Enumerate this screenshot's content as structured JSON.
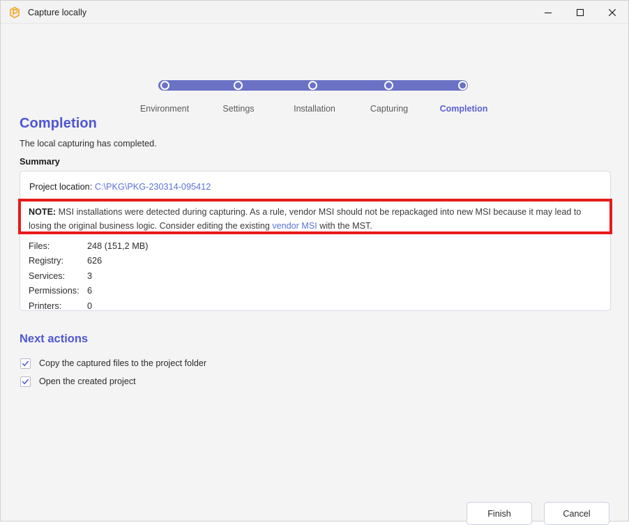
{
  "window": {
    "title": "Capture locally",
    "app_icon": "app-logo-icon",
    "controls": {
      "minimize": "minimize-icon",
      "maximize": "maximize-icon",
      "close": "close-icon"
    }
  },
  "stepper": {
    "steps": [
      {
        "label": "Environment",
        "state": "done"
      },
      {
        "label": "Settings",
        "state": "done"
      },
      {
        "label": "Installation",
        "state": "done"
      },
      {
        "label": "Capturing",
        "state": "done"
      },
      {
        "label": "Completion",
        "state": "active"
      }
    ],
    "accent_color": "#6b72c6",
    "active_label_color": "#5b5fd0"
  },
  "page": {
    "title": "Completion",
    "subtitle": "The local capturing has completed.",
    "title_color": "#4e56d4"
  },
  "summary": {
    "section_label": "Summary",
    "project_location_label": "Project location:",
    "project_location_value": "C:\\PKG\\PKG-230314-095412",
    "note_prefix": "NOTE:",
    "note_text_1": " MSI installations were detected during capturing. As a rule, vendor MSI should not be repackaged into new MSI because it may lead to losing the original business logic. Consider editing the existing ",
    "note_link": "vendor MSI",
    "note_text_2": " with the MST.",
    "stats": [
      {
        "key": "Files:",
        "value": "248 (151,2 MB)"
      },
      {
        "key": "Registry:",
        "value": "626"
      },
      {
        "key": "Services:",
        "value": "3"
      },
      {
        "key": "Permissions:",
        "value": "6"
      },
      {
        "key": "Printers:",
        "value": "0"
      }
    ],
    "link_color": "#5b72d8"
  },
  "annotation": {
    "type": "red-highlight-rectangle",
    "color": "#e81a1a"
  },
  "next_actions": {
    "title": "Next actions",
    "items": [
      {
        "label": "Copy the captured files to the project folder",
        "checked": true
      },
      {
        "label": "Open the created project",
        "checked": true
      }
    ]
  },
  "footer": {
    "finish_label": "Finish",
    "cancel_label": "Cancel"
  }
}
